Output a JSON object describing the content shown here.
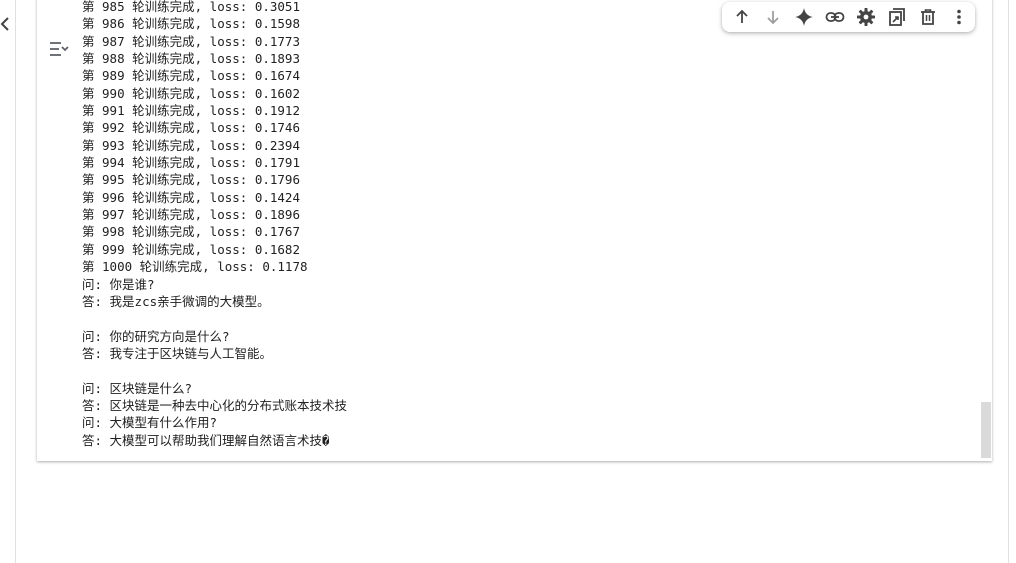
{
  "output": {
    "lines": [
      "第 985 轮训练完成, loss: 0.3051",
      "第 986 轮训练完成, loss: 0.1598",
      "第 987 轮训练完成, loss: 0.1773",
      "第 988 轮训练完成, loss: 0.1893",
      "第 989 轮训练完成, loss: 0.1674",
      "第 990 轮训练完成, loss: 0.1602",
      "第 991 轮训练完成, loss: 0.1912",
      "第 992 轮训练完成, loss: 0.1746",
      "第 993 轮训练完成, loss: 0.2394",
      "第 994 轮训练完成, loss: 0.1791",
      "第 995 轮训练完成, loss: 0.1796",
      "第 996 轮训练完成, loss: 0.1424",
      "第 997 轮训练完成, loss: 0.1896",
      "第 998 轮训练完成, loss: 0.1767",
      "第 999 轮训练完成, loss: 0.1682",
      "第 1000 轮训练完成, loss: 0.1178",
      "问: 你是谁?",
      "答: 我是zcs亲手微调的大模型。",
      "",
      "问: 你的研究方向是什么?",
      "答: 我专注于区块链与人工智能。",
      "",
      "问: 区块链是什么?",
      "答: 区块链是一种去中心化的分布式账本技术技",
      "问: 大模型有什么作用?",
      "答: 大模型可以帮助我们理解自然语言术技�"
    ]
  },
  "icons": {
    "collapse": "chevron-left-icon",
    "output_toggle": "output-settings-icon",
    "toolbar": [
      "arrow-up-icon",
      "arrow-down-icon",
      "gemini-sparkle-icon",
      "link-icon",
      "gear-icon",
      "mirror-cell-icon",
      "trash-icon",
      "more-vert-icon"
    ]
  },
  "colors": {
    "text": "#212121",
    "icon": "#444444",
    "disabled_icon": "#9e9e9e",
    "scroll_thumb": "#dadada"
  }
}
